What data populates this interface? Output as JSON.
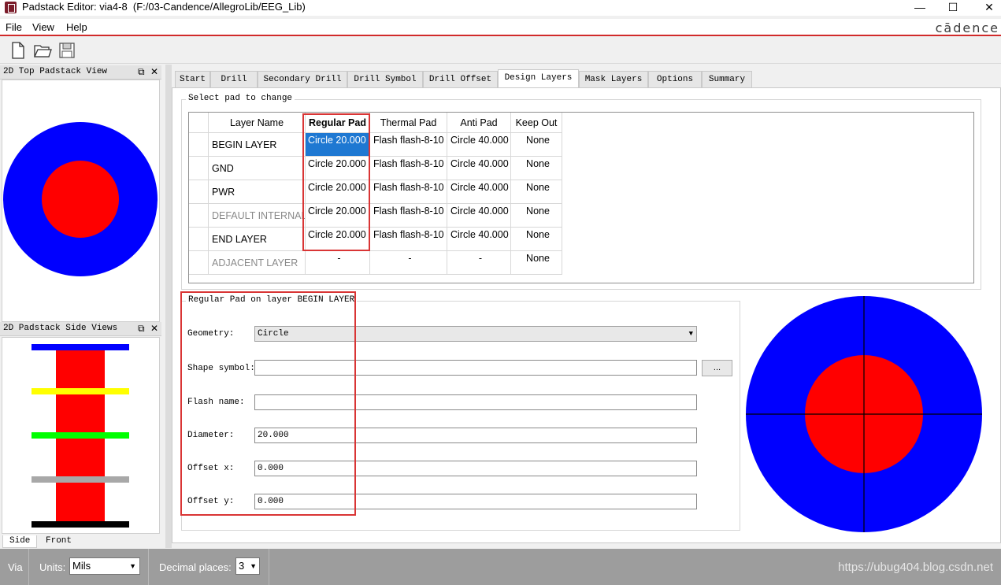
{
  "window": {
    "title": "Padstack Editor: via4-8  (F:/03-Candence/AllegroLib/EEG_Lib)",
    "brand": "cādence"
  },
  "menu": [
    {
      "label": "File"
    },
    {
      "label": "View"
    },
    {
      "label": "Help"
    }
  ],
  "left_panels": {
    "top_view_title": "2D Top Padstack View",
    "side_views_title": "2D Padstack Side Views",
    "side_tab": "Side",
    "front_tab": "Front"
  },
  "tabs": [
    {
      "label": "Start"
    },
    {
      "label": "Drill"
    },
    {
      "label": "Secondary Drill"
    },
    {
      "label": "Drill Symbol"
    },
    {
      "label": "Drill Offset"
    },
    {
      "label": "Design Layers",
      "active": true
    },
    {
      "label": "Mask Layers"
    },
    {
      "label": "Options"
    },
    {
      "label": "Summary"
    }
  ],
  "select_group_label": "Select pad to change",
  "grid": {
    "headers": [
      "Layer Name",
      "Regular Pad",
      "Thermal Pad",
      "Anti Pad",
      "Keep Out"
    ],
    "rows": [
      {
        "layer": "BEGIN LAYER",
        "regular": "Circle 20.000",
        "thermal": "Flash flash-8-10",
        "anti": "Circle 40.000",
        "keepout": "None"
      },
      {
        "layer": "GND",
        "regular": "Circle 20.000",
        "thermal": "Flash flash-8-10",
        "anti": "Circle 40.000",
        "keepout": "None"
      },
      {
        "layer": "PWR",
        "regular": "Circle 20.000",
        "thermal": "Flash flash-8-10",
        "anti": "Circle 40.000",
        "keepout": "None"
      },
      {
        "layer": "DEFAULT INTERNAL",
        "regular": "Circle 20.000",
        "thermal": "Flash flash-8-10",
        "anti": "Circle 40.000",
        "keepout": "None"
      },
      {
        "layer": "END LAYER",
        "regular": "Circle 20.000",
        "thermal": "Flash flash-8-10",
        "anti": "Circle 40.000",
        "keepout": "None"
      },
      {
        "layer": "ADJACENT LAYER",
        "regular": "-",
        "thermal": "-",
        "anti": "-",
        "keepout": "None"
      }
    ]
  },
  "pad_group_label": "Regular Pad on layer BEGIN LAYER",
  "form": {
    "geometry_label": "Geometry:",
    "geometry_value": "Circle",
    "shape_label": "Shape symbol:",
    "shape_value": "",
    "shape_button": "...",
    "flash_label": "Flash name:",
    "flash_value": "",
    "diameter_label": "Diameter:",
    "diameter_value": "20.000",
    "offx_label": "Offset x:",
    "offx_value": "0.000",
    "offy_label": "Offset y:",
    "offy_value": "0.000"
  },
  "status": {
    "mode": "Via",
    "units_label": "Units:",
    "units_value": "Mils",
    "decimal_label": "Decimal places:",
    "decimal_value": "3",
    "watermark": "https://ubug404.blog.csdn.net"
  },
  "colors": {
    "pad": "#ff0000",
    "antipad": "#0000ff",
    "selection": "#1e78d2",
    "highlight_box": "#d93535"
  }
}
